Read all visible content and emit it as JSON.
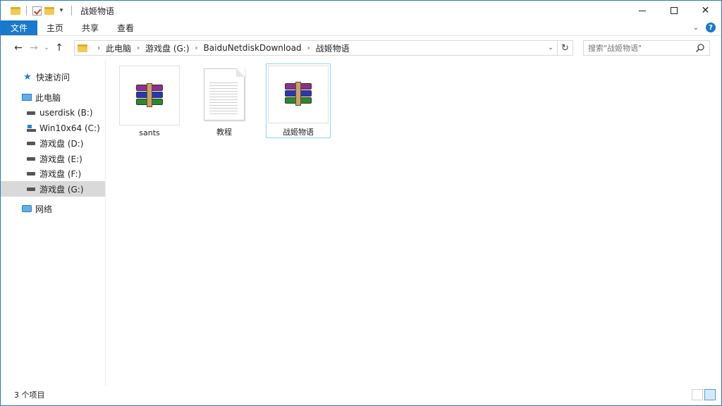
{
  "window": {
    "title": "战姬物语"
  },
  "ribbon": {
    "tabs": [
      "文件",
      "主页",
      "共享",
      "查看"
    ]
  },
  "address": {
    "crumbs": [
      "此电脑",
      "游戏盘 (G:)",
      "BaiduNetdiskDownload",
      "战姬物语"
    ]
  },
  "search": {
    "placeholder": "搜索\"战姬物语\""
  },
  "navpane": {
    "quick_access": "快速访问",
    "this_pc": "此电脑",
    "drives": [
      "userdisk (B:)",
      "Win10x64 (C:)",
      "游戏盘 (D:)",
      "游戏盘 (E:)",
      "游戏盘 (F:)",
      "游戏盘 (G:)"
    ],
    "selected_drive": "游戏盘 (G:)",
    "network": "网络"
  },
  "files": [
    {
      "name": "sants",
      "icon": "winrar-archive-icon"
    },
    {
      "name": "教程",
      "icon": "text-document-icon"
    },
    {
      "name": "战姬物语",
      "icon": "winrar-archive-icon",
      "selected": true
    }
  ],
  "status": {
    "item_count": "3 个项目"
  },
  "colors": {
    "accent": "#1979ca",
    "selection": "#99d1ff"
  }
}
